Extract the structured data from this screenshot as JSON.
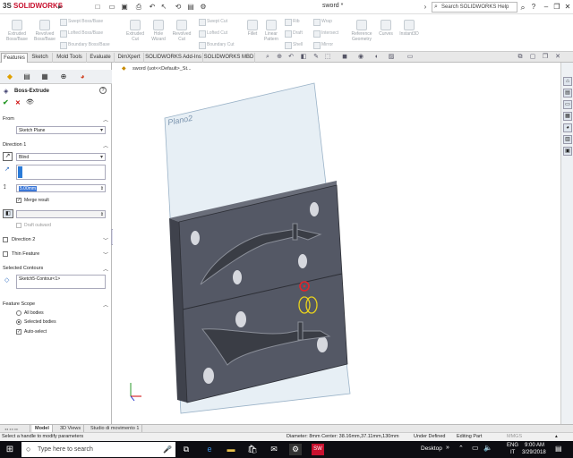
{
  "app": {
    "brand_logo": "SOLIDWORKS",
    "doc_title": "sword *"
  },
  "search": {
    "placeholder": "Search SOLIDWORKS Help"
  },
  "ribbon": {
    "extruded_boss": "Extruded Boss/Base",
    "revolved_boss": "Revolved Boss/Base",
    "swept_boss": "Swept Boss/Base",
    "lofted_boss": "Lofted Boss/Base",
    "boundary_boss": "Boundary Boss/Base",
    "extruded_cut": "Extruded Cut",
    "hole_wizard": "Hole Wizard",
    "revolved_cut": "Revolved Cut",
    "swept_cut": "Swept Cut",
    "lofted_cut": "Lofted Cut",
    "boundary_cut": "Boundary Cut",
    "fillet": "Fillet",
    "linear_pattern": "Linear Pattern",
    "rib": "Rib",
    "draft": "Draft",
    "shell": "Shell",
    "wrap": "Wrap",
    "intersect": "Intersect",
    "mirror": "Mirror",
    "reference_geometry": "Reference Geometry",
    "curves": "Curves",
    "instant3d": "Instant3D"
  },
  "cm_tabs": [
    "Features",
    "Sketch",
    "Mold Tools",
    "Evaluate",
    "DimXpert",
    "SOLIDWORKS Add-Ins",
    "SOLIDWORKS MBD"
  ],
  "tree_path": "sword  (uot<<Default>_St...",
  "property_manager": {
    "title": "Boss-Extrude",
    "from_label": "From",
    "from_value": "Sketch Plane",
    "direction1_label": "Direction 1",
    "end_condition": "Blind",
    "depth_value": "5.00mm",
    "merge_result": "Merge result",
    "draft_outward": "Draft outward",
    "direction2_label": "Direction 2",
    "thin_feature_label": "Thin Feature",
    "selected_contours_label": "Selected Contours",
    "contour_value": "Sketch5-Contour<1>",
    "feature_scope_label": "Feature Scope",
    "all_bodies": "All bodies",
    "selected_bodies": "Selected bodies",
    "auto_select": "Auto-select"
  },
  "viewport": {
    "plane_label": "Plano2"
  },
  "bottom_tabs": [
    "Model",
    "3D Views",
    "Studio di movimento 1"
  ],
  "status": {
    "hint": "Select a handle to modify parameters",
    "diameter": "Diameter: 8mm  Center: 38.16mm,37.11mm,130mm",
    "defined": "Under Defined",
    "mode": "Editing Part",
    "units": "MMGS"
  },
  "taskbar": {
    "search_placeholder": "Type here to search",
    "desktop": "Desktop",
    "lang": "ENG",
    "region": "IT",
    "time": "9:00 AM",
    "date": "3/29/2018"
  }
}
